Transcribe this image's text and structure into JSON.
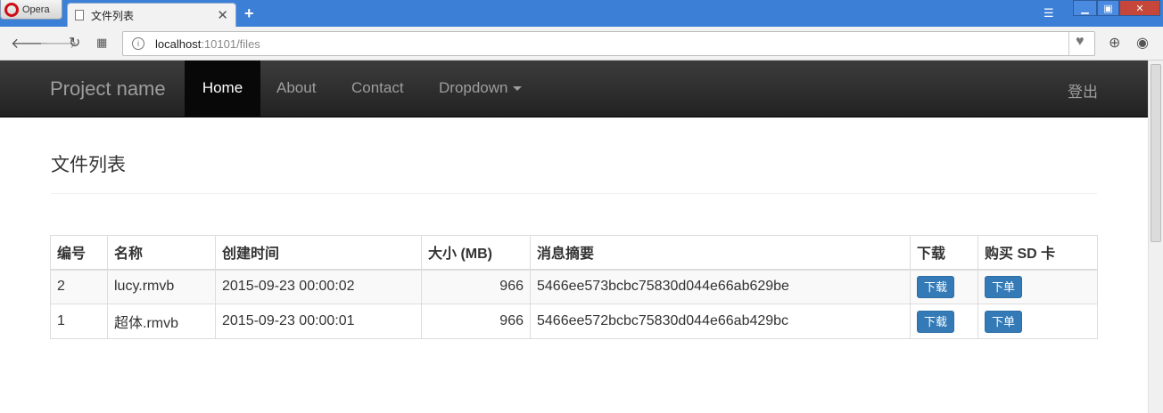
{
  "browser": {
    "opera_label": "Opera",
    "tab_title": "文件列表",
    "tab_close": "✕",
    "new_tab": "+",
    "url_host": "localhost",
    "url_rest": ":10101/files",
    "minimize": "▁",
    "maximize": "▣",
    "close": "✕"
  },
  "navbar": {
    "brand": "Project name",
    "items": [
      {
        "label": "Home",
        "active": true
      },
      {
        "label": "About"
      },
      {
        "label": "Contact"
      },
      {
        "label": "Dropdown"
      }
    ],
    "logout": "登出"
  },
  "page": {
    "title": "文件列表"
  },
  "table": {
    "headers": [
      "编号",
      "名称",
      "创建时间",
      "大小 (MB)",
      "消息摘要",
      "下载",
      "购买 SD 卡"
    ],
    "rows": [
      {
        "id": "2",
        "name": "lucy.rmvb",
        "created": "2015-09-23 00:00:02",
        "size": "966",
        "digest": "5466ee573bcbc75830d044e66ab629be",
        "download": "下载",
        "order": "下单"
      },
      {
        "id": "1",
        "name": "超体.rmvb",
        "created": "2015-09-23 00:00:01",
        "size": "966",
        "digest": "5466ee572bcbc75830d044e66ab429bc",
        "download": "下载",
        "order": "下单"
      }
    ]
  },
  "colors": {
    "navbar": "#222222",
    "button": "#337ab7",
    "titlebar": "#3c7fd6"
  }
}
